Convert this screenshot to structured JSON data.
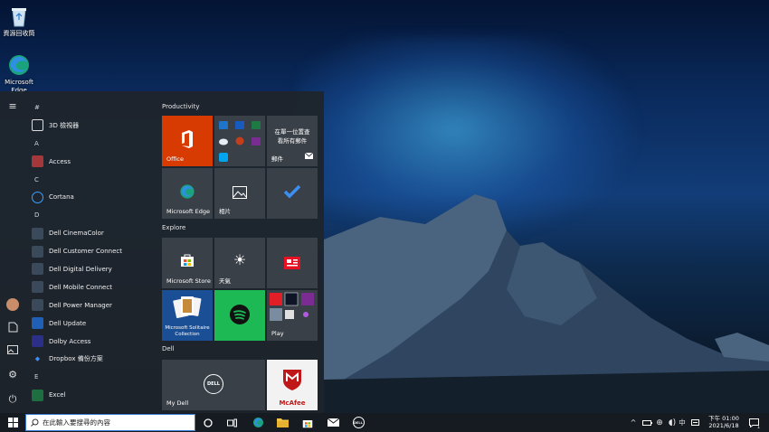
{
  "desktop": {
    "recycle_bin": "資源回收筒",
    "edge": "Microsoft Edge"
  },
  "start": {
    "apps": [
      {
        "type": "h",
        "text": "#"
      },
      {
        "type": "a",
        "text": "3D 檢視器",
        "icon": "cube-icon",
        "color": "transparent"
      },
      {
        "type": "h",
        "text": "A"
      },
      {
        "type": "a",
        "text": "Access",
        "icon": "access-icon",
        "color": "#a4373a"
      },
      {
        "type": "h",
        "text": "C"
      },
      {
        "type": "a",
        "text": "Cortana",
        "icon": "cortana-icon",
        "color": "transparent"
      },
      {
        "type": "h",
        "text": "D"
      },
      {
        "type": "a",
        "text": "Dell CinemaColor",
        "icon": "dell-cinemacolor-icon",
        "color": "#3a4a5a"
      },
      {
        "type": "a",
        "text": "Dell Customer Connect",
        "icon": "chat-icon",
        "color": "#3a4a5a"
      },
      {
        "type": "a",
        "text": "Dell Digital Delivery",
        "icon": "delivery-icon",
        "color": "#3a4a5a"
      },
      {
        "type": "a",
        "text": "Dell Mobile Connect",
        "icon": "phone-icon",
        "color": "#3a4a5a"
      },
      {
        "type": "a",
        "text": "Dell Power Manager",
        "icon": "shield-icon",
        "color": "#3a4a5a"
      },
      {
        "type": "a",
        "text": "Dell Update",
        "icon": "update-icon",
        "color": "#1f5fb5"
      },
      {
        "type": "a",
        "text": "Dolby Access",
        "icon": "dolby-icon",
        "color": "#2b2f88"
      },
      {
        "type": "a",
        "text": "Dropbox 備份方案",
        "icon": "dropbox-icon",
        "color": "transparent"
      },
      {
        "type": "h",
        "text": "E"
      },
      {
        "type": "a",
        "text": "Excel",
        "icon": "excel-icon",
        "color": "#1d6f42"
      }
    ],
    "groups": {
      "productivity": "Productivity",
      "explore": "Explore",
      "dell": "Dell"
    },
    "tiles": {
      "office": "Office",
      "mail_text": "在單一位置查看所有郵件",
      "mail": "郵件",
      "edge": "Microsoft Edge",
      "photos": "相片",
      "store": "Microsoft Store",
      "weather": "天氣",
      "solitaire": "Microsoft Solitaire Collection",
      "play": "Play",
      "mydell": "My Dell",
      "mcafee": "McAfee",
      "dell_logo": "DELL"
    }
  },
  "taskbar": {
    "search_placeholder": "在此輸入要搜尋的內容",
    "ime": "中",
    "time": "下午 01:00",
    "date": "2021/6/18",
    "dell_logo": "DELL",
    "notification_count": "1"
  },
  "colors": {
    "office": "#d83b01",
    "start_bg": "#1e242c",
    "tile": "#3a4048",
    "accent": "#0078d4",
    "spotify": "#1db954"
  }
}
